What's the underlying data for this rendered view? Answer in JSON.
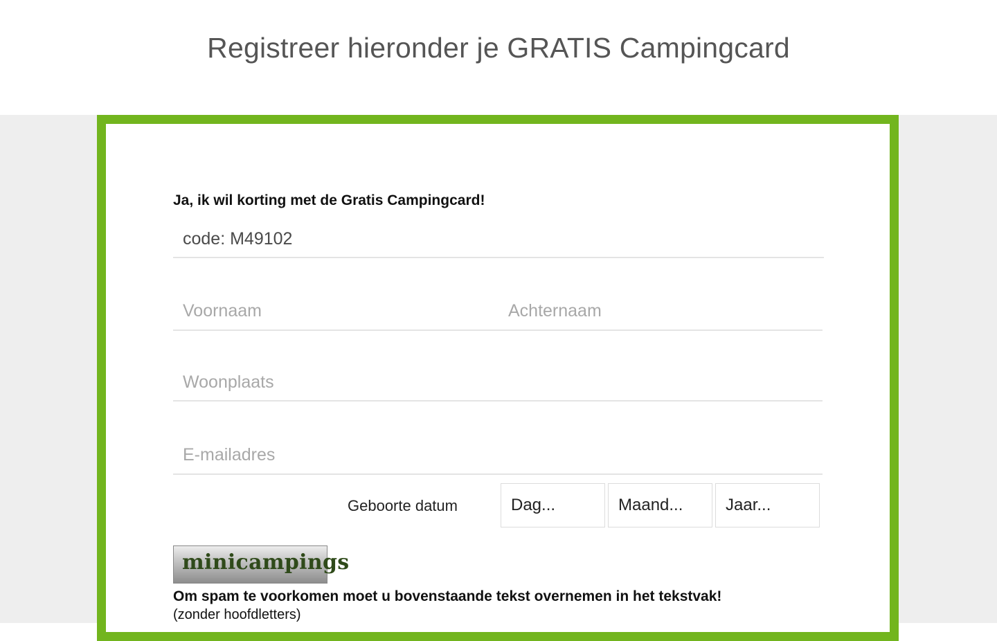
{
  "page": {
    "title": "Registreer hieronder je GRATIS Campingcard"
  },
  "form": {
    "intro": "Ja, ik wil korting met de Gratis Campingcard!",
    "code_value": "code: M49102",
    "first_name_placeholder": "Voornaam",
    "last_name_placeholder": "Achternaam",
    "city_placeholder": "Woonplaats",
    "email_placeholder": "E-mailadres",
    "dob_label": "Geboorte datum",
    "dob_day_placeholder": "Dag...",
    "dob_month_placeholder": "Maand...",
    "dob_year_placeholder": "Jaar...",
    "captcha_text": "minicampings",
    "spam_note": "Om spam te voorkomen moet u bovenstaande tekst overnemen in het tekstvak!",
    "spam_sub": "(zonder hoofdletters)"
  },
  "colors": {
    "accent_green": "#72b51e",
    "background_gray": "#eeeeee"
  }
}
